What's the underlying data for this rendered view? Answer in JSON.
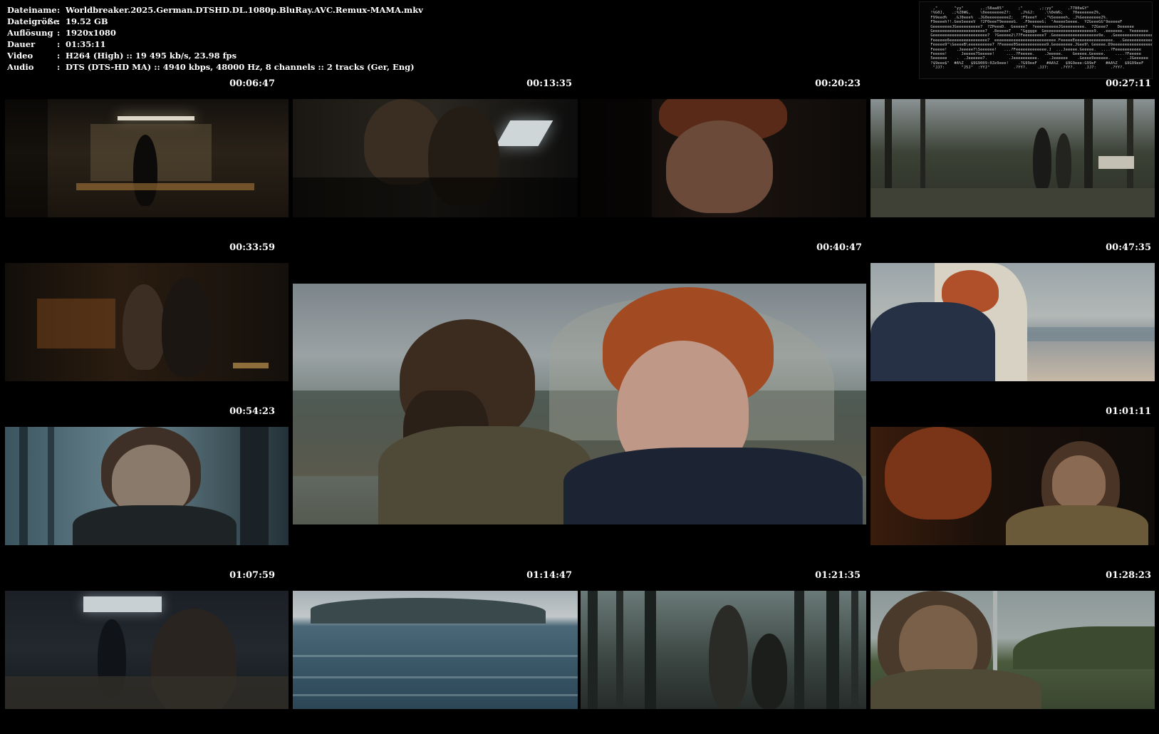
{
  "info": {
    "rows": [
      {
        "key": "Dateiname",
        "value": "Worldbreaker.2025.German.DTSHD.DL.1080p.BluRay.AVC.Remux-MAMA.mkv"
      },
      {
        "key": "Dateigröße",
        "value": "19.52 GB"
      },
      {
        "key": "Auflösung",
        "value": "1920x1080"
      },
      {
        "key": "Dauer",
        "value": "01:35:11"
      },
      {
        "key": "Video",
        "value": "H264 (High) :: 19 495 kb/s, 23.98 fps"
      },
      {
        "key": "Audio",
        "value": "DTS (DTS-HD MA) :: 4940 kbps, 48000 Hz, 8 channels :: 2 tracks (Ger, Eng)"
      }
    ],
    "separator": ":"
  },
  "logo": {
    "icon": "mama-ascii-logo",
    "text": "MAMA"
  },
  "timestamps": {
    "t1": "00:06:47",
    "t2": "00:13:35",
    "t3": "00:20:23",
    "t4": "00:27:11",
    "t5": "00:33:59",
    "t6": "00:40:47",
    "t7": "00:47:35",
    "t8": "00:54:23",
    "t9": "01:01:11",
    "t10": "01:07:59",
    "t11": "01:14:47",
    "t12": "01:21:35",
    "t13": "01:28:23"
  },
  "colors": {
    "background": "#000000",
    "text": "#ffffff"
  }
}
